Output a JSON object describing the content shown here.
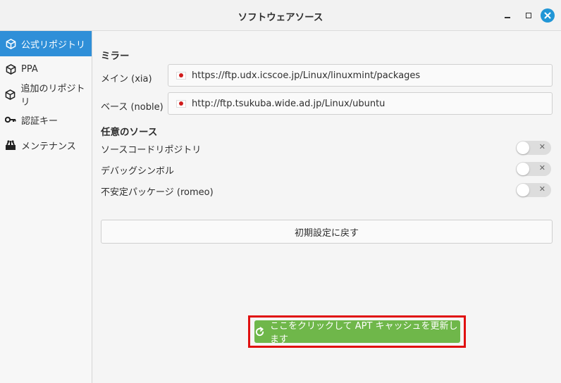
{
  "window": {
    "title": "ソフトウェアソース"
  },
  "sidebar": {
    "items": [
      {
        "label": "公式リポジトリ",
        "icon": "box-icon",
        "active": true
      },
      {
        "label": "PPA",
        "icon": "box-icon",
        "active": false
      },
      {
        "label": "追加のリポジトリ",
        "icon": "box-icon",
        "active": false
      },
      {
        "label": "認証キー",
        "icon": "key-icon",
        "active": false
      },
      {
        "label": "メンテナンス",
        "icon": "maintenance-icon",
        "active": false
      }
    ]
  },
  "mirrors": {
    "heading": "ミラー",
    "main": {
      "label": "メイン (xia)",
      "url": "https://ftp.udx.icscoe.jp/Linux/linuxmint/packages"
    },
    "base": {
      "label": "ベース (noble)",
      "url": "http://ftp.tsukuba.wide.ad.jp/Linux/ubuntu"
    }
  },
  "optional": {
    "heading": "任意のソース",
    "items": [
      {
        "label": "ソースコードリポジトリ",
        "enabled": false
      },
      {
        "label": "デバッグシンボル",
        "enabled": false
      },
      {
        "label": "不安定パッケージ (romeo)",
        "enabled": false
      }
    ]
  },
  "buttons": {
    "reset": "初期設定に戻す",
    "update_apt": "ここをクリックして APT キャッシュを更新します"
  },
  "colors": {
    "accent": "#2f8fd8",
    "update_button": "#6fb74a",
    "highlight": "#e01010"
  }
}
